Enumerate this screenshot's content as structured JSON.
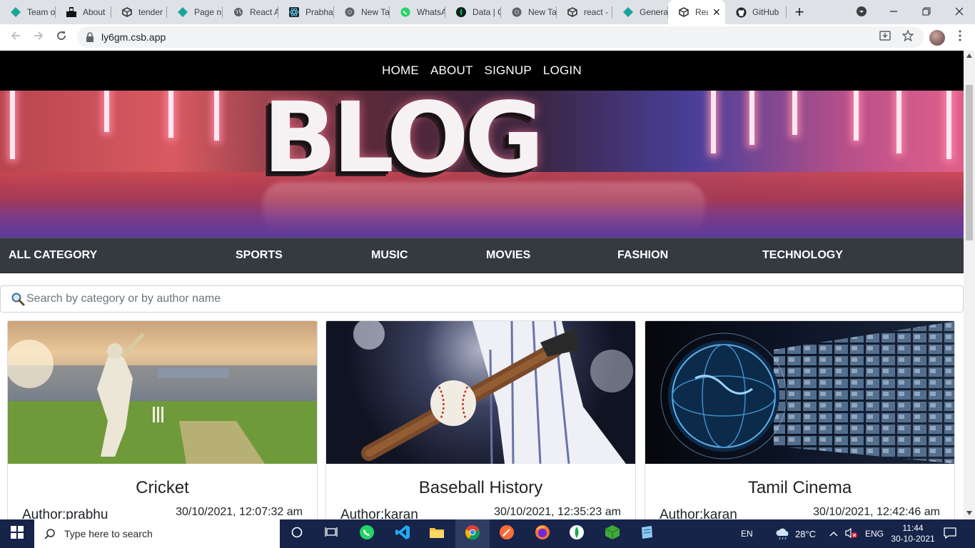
{
  "browser": {
    "tabs": [
      {
        "label": "Team o",
        "icon": "codesandbox-diamond-icon"
      },
      {
        "label": "About",
        "icon": "site-logo-icon"
      },
      {
        "label": "tender",
        "icon": "codesandbox-cube-icon"
      },
      {
        "label": "Page n",
        "icon": "codesandbox-diamond-icon"
      },
      {
        "label": "React A",
        "icon": "globe-icon"
      },
      {
        "label": "Prabha",
        "icon": "react-icon"
      },
      {
        "label": "New Ta",
        "icon": "chrome-icon"
      },
      {
        "label": "WhatsA",
        "icon": "whatsapp-icon"
      },
      {
        "label": "Data | C",
        "icon": "mongodb-leaf-icon"
      },
      {
        "label": "New Ta",
        "icon": "chrome-icon"
      },
      {
        "label": "react -",
        "icon": "codesandbox-cube-icon"
      },
      {
        "label": "Genera",
        "icon": "codesandbox-diamond-icon"
      }
    ],
    "active_tab": {
      "label": "Rea",
      "close": "✕"
    },
    "github_tab": {
      "label": "GitHub"
    },
    "new_tab": "+",
    "url": "ly6gm.csb.app"
  },
  "site": {
    "nav": {
      "home": "HOME",
      "about": "ABOUT",
      "signup": "SIGNUP",
      "login": "LOGIN"
    },
    "hero_text": "BLOG",
    "categories": {
      "all": "ALL CATEGORY",
      "sports": "SPORTS",
      "music": "MUSIC",
      "movies": "MOVIES",
      "fashion": "FASHION",
      "technology": "TECHNOLOGY"
    },
    "search": {
      "placeholder": "Search by category or by author name"
    },
    "posts": [
      {
        "title": "Cricket",
        "author": "Author:prabhu",
        "date": "30/10/2021, 12:07:32 am"
      },
      {
        "title": "Baseball History",
        "author": "Author:karan",
        "date": "30/10/2021, 12:35:23 am"
      },
      {
        "title": "Tamil Cinema",
        "author": "Author:karan",
        "date": "30/10/2021, 12:42:46 am"
      }
    ]
  },
  "taskbar": {
    "search_placeholder": "Type here to search",
    "lang": "EN",
    "temperature": "28°C",
    "input": "ENG",
    "time": "11:44",
    "date": "30-10-2021"
  }
}
